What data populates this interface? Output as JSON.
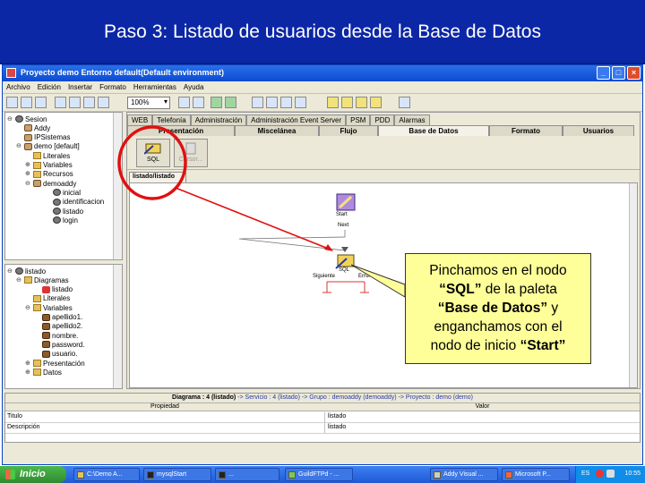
{
  "slide": {
    "title": "Paso 3: Listado de usuarios desde la Base de Datos"
  },
  "window": {
    "title": "Proyecto demo Entorno default(Default environment)",
    "buttons": [
      "_",
      "□",
      "×"
    ]
  },
  "menubar": [
    "Archivo",
    "Edición",
    "Insertar",
    "Formato",
    "Herramientas",
    "Ayuda"
  ],
  "toolbar": {
    "zoom": "100%"
  },
  "tree1": [
    {
      "label": "Sesion",
      "icon": "gear-icon",
      "toggle": "⊖"
    },
    {
      "label": "Addy",
      "icon": "db-icon",
      "toggle": ""
    },
    {
      "label": "IPSistemas",
      "icon": "db-icon",
      "toggle": ""
    },
    {
      "label": "demo [default]",
      "icon": "db-icon",
      "toggle": "⊖"
    },
    {
      "label": "Literales",
      "icon": "folder-icon",
      "toggle": ""
    },
    {
      "label": "Variables",
      "icon": "folder-icon",
      "toggle": "⊕"
    },
    {
      "label": "Recursos",
      "icon": "folder-icon",
      "toggle": "⊕"
    },
    {
      "label": "demoaddy",
      "icon": "db-icon",
      "toggle": "⊖"
    },
    {
      "label": "inicial",
      "icon": "gear-icon",
      "toggle": ""
    },
    {
      "label": "identificacion",
      "icon": "gear-icon",
      "toggle": ""
    },
    {
      "label": "listado",
      "icon": "gear-icon",
      "toggle": ""
    },
    {
      "label": "login",
      "icon": "gear-icon",
      "toggle": ""
    }
  ],
  "tree2": [
    {
      "label": "listado",
      "icon": "gear-icon",
      "toggle": "⊖"
    },
    {
      "label": "Diagramas",
      "icon": "folder-icon",
      "toggle": "⊖"
    },
    {
      "label": "listado",
      "icon": "diagram-icon",
      "toggle": ""
    },
    {
      "label": "Literales",
      "icon": "folder-icon",
      "toggle": ""
    },
    {
      "label": "Variables",
      "icon": "folder-icon",
      "toggle": "⊖"
    },
    {
      "label": "apellido1.",
      "icon": "variable-icon",
      "toggle": ""
    },
    {
      "label": "apellido2.",
      "icon": "variable-icon",
      "toggle": ""
    },
    {
      "label": "nombre.",
      "icon": "variable-icon",
      "toggle": ""
    },
    {
      "label": "password.",
      "icon": "variable-icon",
      "toggle": ""
    },
    {
      "label": "usuario.",
      "icon": "variable-icon",
      "toggle": ""
    },
    {
      "label": "Presentación",
      "icon": "folder-icon",
      "toggle": "⊕"
    },
    {
      "label": "Datos",
      "icon": "folder-icon",
      "toggle": "⊕"
    }
  ],
  "tabs_row1": [
    "WEB",
    "Telefonía",
    "Administración",
    "Administración Event Server",
    "PSM",
    "PDD",
    "Alarmas"
  ],
  "tabs_row2": [
    "Presentación",
    "Miscelánea",
    "Flujo",
    "Base de Datos",
    "Formato",
    "Usuarios"
  ],
  "palette": [
    {
      "label": "SQL",
      "icon": "sql-icon"
    },
    {
      "label": "Cursor...",
      "icon": "cursor-icon"
    }
  ],
  "document_tab": "listado/listado",
  "diagram": {
    "start_label": "Start",
    "next_label": "Next",
    "sql_label": "SQL",
    "siguiente_label": "Siguiente",
    "error_label": "Error"
  },
  "properties": {
    "title": "Diagrama : 4 (listado)",
    "breadcrumb": "-> Servicio : 4 (listado) -> Grupo : demoaddy (demoaddy) -> Proyecto : demo (demo)",
    "col_prop": "Propiedad",
    "col_val": "Valor",
    "rows": [
      {
        "prop": "Titulo",
        "val": "listado"
      },
      {
        "prop": "Descripción",
        "val": "listado"
      }
    ]
  },
  "taskbar": {
    "start": "Inicio",
    "tasks": [
      "C:\\Demo A...",
      "mysqlStart",
      "...",
      "GuildFTPd - ...",
      "Addy Visual ...",
      "Microsoft P..."
    ],
    "lang": "ES",
    "clock": "10:55"
  },
  "callout": {
    "line1": "Pinchamos en el nodo",
    "sql": "“SQL”",
    "line2": " de la paleta",
    "bd": "“Base de Datos”",
    "line3": " y",
    "line4": "enganchamos con el",
    "line5": "nodo de inicio ",
    "start": "“Start”"
  },
  "colors": {
    "slide_header": "#0b27a6",
    "highlight_circle": "#e01010",
    "callout_bg": "#ffff99"
  }
}
